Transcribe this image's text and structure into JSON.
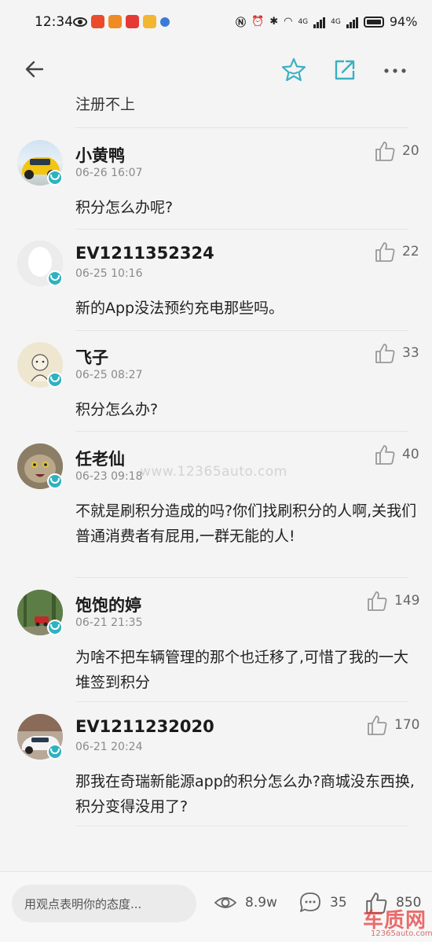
{
  "status_bar": {
    "time": "12:34",
    "signal_1": "4G",
    "signal_2": "4G",
    "battery": "94%"
  },
  "top_bar": {
    "back_icon": "arrow-left-icon",
    "favorite_icon": "star-icon",
    "share_icon": "share-icon",
    "more_icon": "more-dots-icon"
  },
  "previous_comment_tail": "注册不上",
  "comments": [
    {
      "name": "小黄鸭",
      "time": "06-26 16:07",
      "likes": "20",
      "text": "积分怎么办呢?"
    },
    {
      "name": "EV1211352324",
      "time": "06-25 10:16",
      "likes": "22",
      "text": "新的App没法预约充电那些吗。"
    },
    {
      "name": "飞子",
      "time": "06-25 08:27",
      "likes": "33",
      "text": "积分怎么办?"
    },
    {
      "name": "任老仙",
      "time": "06-23 09:18",
      "likes": "40",
      "text": "不就是刷积分造成的吗?你们找刷积分的人啊,关我们普通消费者有屁用,一群无能的人!"
    },
    {
      "name": "饱饱的婷",
      "time": "06-21 21:35",
      "likes": "149",
      "text": "为啥不把车辆管理的那个也迁移了,可惜了我的一大堆签到积分"
    },
    {
      "name": "EV1211232020",
      "time": "06-21 20:24",
      "likes": "170",
      "text": "那我在奇瑞新能源app的积分怎么办?商城没东西换,积分变得没用了?"
    }
  ],
  "watermark": "www.12365auto.com",
  "bottom_bar": {
    "input_placeholder": "用观点表明你的态度...",
    "views": "8.9w",
    "comments": "35",
    "likes": "850"
  },
  "brand": {
    "name": "车质网",
    "url": "12365auto.com"
  },
  "colors": {
    "badge": "#2eb2c0",
    "accent_icon": "#3bb0c2"
  }
}
